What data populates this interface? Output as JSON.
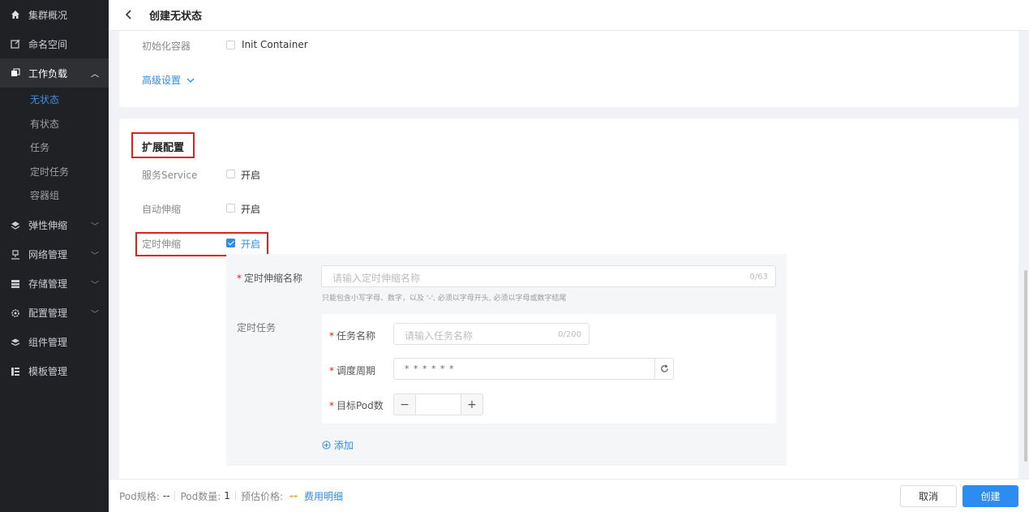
{
  "sidebar": {
    "items": [
      {
        "label": "集群概况",
        "icon": "home-icon"
      },
      {
        "label": "命名空间",
        "icon": "edit-icon"
      },
      {
        "label": "工作负载",
        "icon": "workload-icon"
      },
      {
        "label": "弹性伸缩",
        "icon": "scale-icon"
      },
      {
        "label": "网络管理",
        "icon": "network-icon"
      },
      {
        "label": "存储管理",
        "icon": "storage-icon"
      },
      {
        "label": "配置管理",
        "icon": "config-icon"
      },
      {
        "label": "组件管理",
        "icon": "component-icon"
      },
      {
        "label": "模板管理",
        "icon": "template-icon"
      }
    ],
    "workload_sub": [
      "无状态",
      "有状态",
      "任务",
      "定时任务",
      "容器组"
    ]
  },
  "header": {
    "title": "创建无状态"
  },
  "basic": {
    "init_label": "初始化容器",
    "init_text": "Init Container",
    "advanced_link": "高级设置"
  },
  "extension": {
    "title": "扩展配置",
    "service_label": "服务Service",
    "service_text": "开启",
    "autoscale_label": "自动伸缩",
    "autoscale_text": "开启",
    "cron_label": "定时伸缩",
    "cron_text": "开启",
    "cron_checked": true
  },
  "cron": {
    "name_label": "定时伸缩名称",
    "name_placeholder": "请输入定时伸缩名称",
    "name_count": "0/63",
    "name_hint": "只能包含小写字母、数字，以及 '-', 必须以字母开头, 必须以字母或数字结尾",
    "task_label": "定时任务",
    "task_name_label": "任务名称",
    "task_name_placeholder": "请输入任务名称",
    "task_name_count": "0/200",
    "schedule_label": "调度周期",
    "schedule_value": "* * * * * *",
    "pods_label": "目标Pod数",
    "pods_value": "",
    "add_link": "添加"
  },
  "footer": {
    "pod_spec_label": "Pod规格:",
    "pod_spec_value": "--",
    "pod_count_label": "Pod数量:",
    "pod_count_value": "1",
    "price_label": "预估价格:",
    "price_value": "--",
    "fee_link": "费用明细",
    "cancel": "取消",
    "create": "创建"
  },
  "colors": {
    "accent": "#2d8cf0",
    "highlight": "#e0201d",
    "sidebar": "#202124",
    "price": "#f0a020"
  }
}
